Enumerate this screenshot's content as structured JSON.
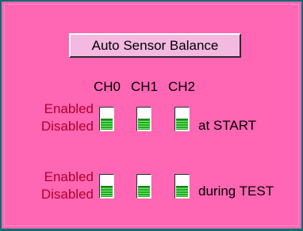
{
  "panel": {
    "button_label": "Auto Sensor Balance",
    "channels": [
      "CH0",
      "CH1",
      "CH2"
    ],
    "rows": [
      {
        "enabled_label": "Enabled",
        "disabled_label": "Disabled",
        "suffix": "at START",
        "states": [
          "Disabled",
          "Disabled",
          "Disabled"
        ]
      },
      {
        "enabled_label": "Enabled",
        "disabled_label": "Disabled",
        "suffix": "during TEST",
        "states": [
          "Disabled",
          "Disabled",
          "Disabled"
        ]
      }
    ],
    "colors": {
      "background": "#ff66b3",
      "frame": "#0b6d70",
      "label_red": "#b0002a",
      "toggle_green": "#1fae1f"
    }
  }
}
